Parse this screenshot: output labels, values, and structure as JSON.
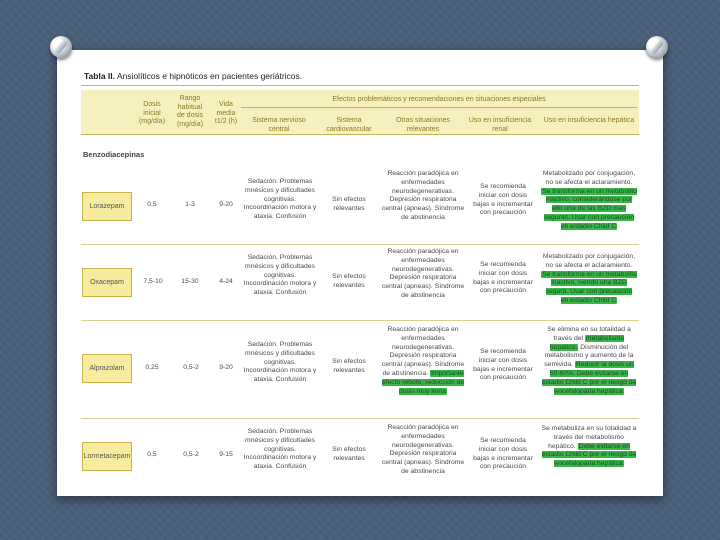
{
  "title": {
    "label": "Tabla II.",
    "text": " Ansiolíticos e hipnóticos en pacientes geriátricos."
  },
  "headers": {
    "dose": "Dosis inicial (mg/día)",
    "range": "Rango habitual de dosis (mg/día)",
    "halflife": "Vida media t1/2 (h)",
    "group": "Efectos problemáticos y recomendaciones en situaciones especiales",
    "cns": "Sistema nervioso central",
    "cardio": "Sistema cardiovascular",
    "other": "Otras situaciones relevantes",
    "renal": "Uso en insuficiencia renal",
    "hepatic": "Uso en insuficiencia hepática"
  },
  "section": "Benzodiacepinas",
  "rows": [
    {
      "drug": "Lorazepam",
      "dose": "0,5",
      "range": "1-3",
      "halflife": "9-20",
      "cns": "Sedación. Problemas mnésicos y dificultades cognitivas. Incoordinación motora y ataxia. Confusión",
      "cardio": "Sin efectos relevantes",
      "other": "Reacción paradójica en enfermedades neurodegenerativas. Depresión respiratoria central (apneas). Síndrome de abstinencia",
      "renal": "Se recomienda iniciar con dosis bajas e incrementar con precaución",
      "hepatic_plain": "Metabolizado por conjugación, no se afecta el aclaramiento.",
      "hepatic_hl": "Se transforma en un metabolito inactivo, considerándose por ello una de las BZD más seguras. Usar con precaución en estadio Child C"
    },
    {
      "drug": "Oxacepam",
      "dose": "7,5-10",
      "range": "15-30",
      "halflife": "4-24",
      "cns": "Sedación. Problemas mnésicos y dificultades cognitivas. Incoordinación motora y ataxia. Confusión",
      "cardio": "Sin efectos relevantes",
      "other": "Reacción paradójica en enfermedades neurodegenerativas. Depresión respiratoria central (apneas). Síndrome de abstinencia",
      "renal": "Se recomienda iniciar con dosis bajas e incrementar con precaución",
      "hepatic_plain": "Metabolizado por conjugación, no se afecta el aclaramiento.",
      "hepatic_hl": "Se transforma en un metabolito inactivo, siendo una BZD segura. Usar con precaución en estadio Child C"
    },
    {
      "drug": "Alprazolam",
      "dose": "0,25",
      "range": "0,5-2",
      "halflife": "9-20",
      "cns": "Sedación. Problemas mnésicos y dificultades cognitivas. Incoordinación motora y ataxia. Confusión",
      "cardio": "Sin efectos relevantes",
      "other": "Reacción paradójica en enfermedades neurodegenerativas. Depresión respiratoria central (apneas). Síndrome de abstinencia.",
      "other_hl": "Importante efecto rebote, reducción de dosis muy lenta",
      "renal": "Se recomienda iniciar con dosis bajas e incrementar con precaución",
      "hepatic_plain": "Se elimina en su totalidad a través del",
      "hepatic_hl": "metabolismo hepático.",
      "hepatic_plain2": "Disminución del metabolismo y aumento de la semivida.",
      "hepatic_hl2": "Reducir la dosis un 50-60%. Debe evitarse en estadio Child C por el riesgo de encefalopatía hepática"
    },
    {
      "drug": "Lormetacepam",
      "dose": "0,5",
      "range": "0,5-2",
      "halflife": "9-15",
      "cns": "Sedación. Problemas mnésicos y dificultades cognitivas. Incoordinación motora y ataxia. Confusión",
      "cardio": "Sin efectos relevantes",
      "other": "Reacción paradójica en enfermedades neurodegenerativas. Depresión respiratoria central (apneas). Síndrome de abstinencia",
      "renal": "Se recomienda iniciar con dosis bajas e incrementar con precaución",
      "hepatic_plain": "Se metaboliza en su totalidad a través del metabolismo hepático.",
      "hepatic_hl": "Debe evitarse en estadio Child C por el riesgo de encefalopatía hepática"
    }
  ]
}
